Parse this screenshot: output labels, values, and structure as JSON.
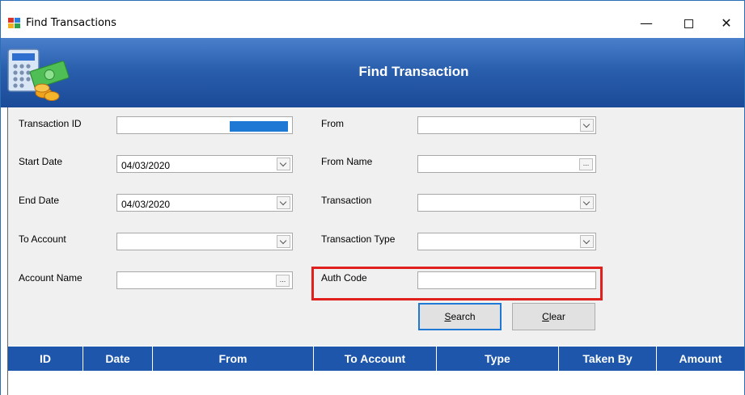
{
  "window": {
    "title": "Find Transactions",
    "minimize_glyph": "—",
    "close_glyph": "✕"
  },
  "header": {
    "title": "Find Transaction",
    "logo_icon": "calculator-money-icon"
  },
  "form": {
    "transaction_id_label": "Transaction ID",
    "start_date_label": "Start Date",
    "start_date_value": "04/03/2020",
    "end_date_label": "End Date",
    "end_date_value": "04/03/2020",
    "to_account_label": "To Account",
    "account_name_label": "Account Name",
    "from_label": "From",
    "from_name_label": "From Name",
    "transaction_label": "Transaction",
    "transaction_type_label": "Transaction Type",
    "auth_code_label": "Auth Code",
    "ellipsis": "..."
  },
  "buttons": {
    "search_underlined": "S",
    "search_rest": "earch",
    "clear_underlined": "C",
    "clear_rest": "lear"
  },
  "grid": {
    "columns": [
      "ID",
      "Date",
      "From",
      "To Account",
      "Type",
      "Taken By",
      "Amount"
    ]
  },
  "colors": {
    "header_blue": "#1d56aa",
    "highlight_red": "#e0201c",
    "focus_blue": "#1e78d4"
  }
}
